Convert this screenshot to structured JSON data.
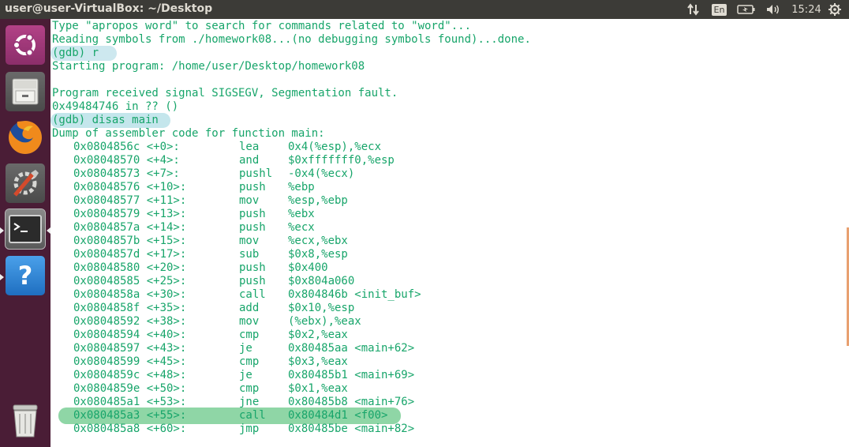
{
  "topbar": {
    "window_title": "user@user-VirtualBox: ~/Desktop",
    "language": "En",
    "clock": "15:24",
    "icons": {
      "network": "network-arrows-icon",
      "battery": "battery-icon",
      "volume": "volume-icon",
      "system": "gear-icon"
    }
  },
  "launcher": {
    "items": [
      {
        "name": "ubuntu-dash",
        "icon": "ubuntu-logo-icon"
      },
      {
        "name": "files",
        "icon": "file-cabinet-icon"
      },
      {
        "name": "firefox",
        "icon": "firefox-icon"
      },
      {
        "name": "system-settings",
        "icon": "settings-tools-icon"
      },
      {
        "name": "terminal",
        "icon": "terminal-icon"
      },
      {
        "name": "help",
        "icon": "help-question-icon"
      },
      {
        "name": "trash",
        "icon": "trash-icon"
      }
    ]
  },
  "terminal": {
    "text_color": "#17a56a",
    "lines": [
      "Type \"apropos word\" to search for commands related to \"word\"...",
      "Reading symbols from ./homework08...(no debugging symbols found)...done.",
      "(gdb) r",
      "Starting program: /home/user/Desktop/homework08",
      "",
      "Program received signal SIGSEGV, Segmentation fault.",
      "0x49484746 in ?? ()",
      "(gdb) disas main",
      "Dump of assembler code for function main:"
    ],
    "disassembly": [
      {
        "addr": "0x0804856c <+0>:",
        "mnemonic": "lea",
        "operands": "0x4(%esp),%ecx"
      },
      {
        "addr": "0x08048570 <+4>:",
        "mnemonic": "and",
        "operands": "$0xfffffff0,%esp"
      },
      {
        "addr": "0x08048573 <+7>:",
        "mnemonic": "pushl",
        "operands": "-0x4(%ecx)"
      },
      {
        "addr": "0x08048576 <+10>:",
        "mnemonic": "push",
        "operands": "%ebp"
      },
      {
        "addr": "0x08048577 <+11>:",
        "mnemonic": "mov",
        "operands": "%esp,%ebp"
      },
      {
        "addr": "0x08048579 <+13>:",
        "mnemonic": "push",
        "operands": "%ebx"
      },
      {
        "addr": "0x0804857a <+14>:",
        "mnemonic": "push",
        "operands": "%ecx"
      },
      {
        "addr": "0x0804857b <+15>:",
        "mnemonic": "mov",
        "operands": "%ecx,%ebx"
      },
      {
        "addr": "0x0804857d <+17>:",
        "mnemonic": "sub",
        "operands": "$0x8,%esp"
      },
      {
        "addr": "0x08048580 <+20>:",
        "mnemonic": "push",
        "operands": "$0x400"
      },
      {
        "addr": "0x08048585 <+25>:",
        "mnemonic": "push",
        "operands": "$0x804a060"
      },
      {
        "addr": "0x0804858a <+30>:",
        "mnemonic": "call",
        "operands": "0x804846b <init_buf>"
      },
      {
        "addr": "0x0804858f <+35>:",
        "mnemonic": "add",
        "operands": "$0x10,%esp"
      },
      {
        "addr": "0x08048592 <+38>:",
        "mnemonic": "mov",
        "operands": "(%ebx),%eax"
      },
      {
        "addr": "0x08048594 <+40>:",
        "mnemonic": "cmp",
        "operands": "$0x2,%eax"
      },
      {
        "addr": "0x08048597 <+43>:",
        "mnemonic": "je",
        "operands": "0x80485aa <main+62>"
      },
      {
        "addr": "0x08048599 <+45>:",
        "mnemonic": "cmp",
        "operands": "$0x3,%eax"
      },
      {
        "addr": "0x0804859c <+48>:",
        "mnemonic": "je",
        "operands": "0x80485b1 <main+69>"
      },
      {
        "addr": "0x0804859e <+50>:",
        "mnemonic": "cmp",
        "operands": "$0x1,%eax"
      },
      {
        "addr": "0x080485a1 <+53>:",
        "mnemonic": "jne",
        "operands": "0x80485b8 <main+76>"
      },
      {
        "addr": "0x080485a3 <+55>:",
        "mnemonic": "call",
        "operands": "0x80484d1 <f00>"
      },
      {
        "addr": "0x080485a8 <+60>:",
        "mnemonic": "jmp",
        "operands": "0x80485be <main+82>"
      }
    ]
  }
}
